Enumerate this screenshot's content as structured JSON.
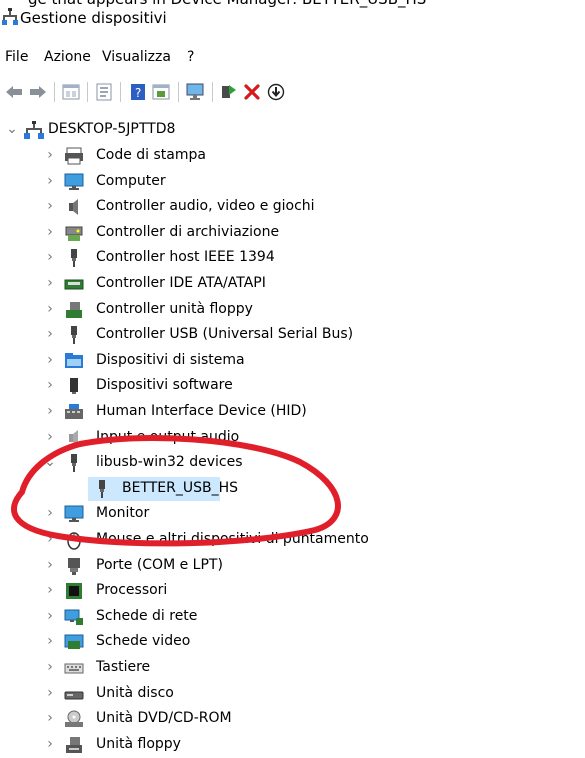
{
  "window": {
    "title": "Gestione dispositivi",
    "top_cut_text": "ge that appears in Device Manager: BETTER_USB_HS"
  },
  "menu": {
    "file": "File",
    "azione": "Azione",
    "visualizza": "Visualizza",
    "help": "?"
  },
  "tree": {
    "root": "DESKTOP-5JPTTD8",
    "items": [
      {
        "label": "Code di stampa",
        "icon": "printer-icon"
      },
      {
        "label": "Computer",
        "icon": "monitor-icon"
      },
      {
        "label": "Controller audio, video e giochi",
        "icon": "speaker-icon"
      },
      {
        "label": "Controller di archiviazione",
        "icon": "storage-icon"
      },
      {
        "label": "Controller host IEEE 1394",
        "icon": "plug-icon"
      },
      {
        "label": "Controller IDE ATA/ATAPI",
        "icon": "ide-icon"
      },
      {
        "label": "Controller unità floppy",
        "icon": "floppy-controller-icon"
      },
      {
        "label": "Controller USB (Universal Serial Bus)",
        "icon": "usb-icon"
      },
      {
        "label": "Dispositivi di sistema",
        "icon": "system-folder-icon"
      },
      {
        "label": "Dispositivi software",
        "icon": "software-device-icon"
      },
      {
        "label": "Human Interface Device (HID)",
        "icon": "hid-icon"
      },
      {
        "label": "Input e output audio",
        "icon": "audio-io-icon"
      },
      {
        "label": "libusb-win32 devices",
        "icon": "usb-plug-icon"
      },
      {
        "label": "BETTER_USB_HS",
        "icon": "usb-plug-icon"
      },
      {
        "label": "Monitor",
        "icon": "monitor-icon"
      },
      {
        "label": "Mouse e altri dispositivi di puntamento",
        "icon": "mouse-icon"
      },
      {
        "label": "Porte (COM e LPT)",
        "icon": "port-icon"
      },
      {
        "label": "Processori",
        "icon": "cpu-icon"
      },
      {
        "label": "Schede di rete",
        "icon": "network-icon"
      },
      {
        "label": "Schede video",
        "icon": "display-adapter-icon"
      },
      {
        "label": "Tastiere",
        "icon": "keyboard-icon"
      },
      {
        "label": "Unità disco",
        "icon": "disk-icon"
      },
      {
        "label": "Unità DVD/CD-ROM",
        "icon": "dvd-icon"
      },
      {
        "label": "Unità floppy",
        "icon": "floppy-icon"
      }
    ]
  },
  "colors": {
    "annotation": "#e01f2b",
    "selection": "#cce8ff",
    "accent_blue": "#1e6fd9"
  }
}
